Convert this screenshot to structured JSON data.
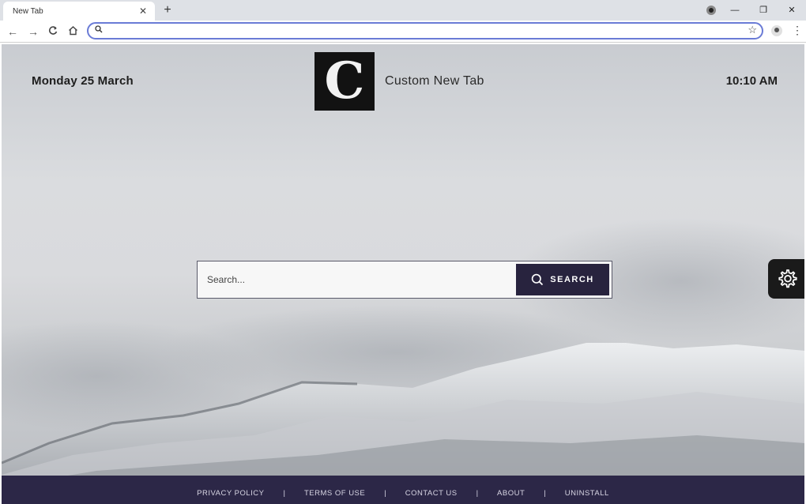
{
  "tab": {
    "title": "New Tab",
    "close": "✕",
    "new": "+"
  },
  "window_controls": {
    "minimize": "—",
    "maximize": "❐",
    "close": "✕"
  },
  "toolbar": {
    "back": "←",
    "forward": "→",
    "reload": "C",
    "home": "⌂",
    "address_value": "",
    "star": "☆",
    "menu": "⋮"
  },
  "page": {
    "date": "Monday 25 March",
    "time": "10:10 AM",
    "logo_letter": "C",
    "brand": "Custom New Tab",
    "search": {
      "placeholder": "Search...",
      "button_label": "SEARCH"
    },
    "footer_links": [
      "PRIVACY POLICY",
      "TERMS OF USE",
      "CONTACT US",
      "ABOUT",
      "UNINSTALL"
    ],
    "footer_separator": "|"
  },
  "colors": {
    "accent": "#28233e",
    "footer_bg": "#2c2747",
    "omnibox_focus": "#6a7bd6"
  },
  "icons": [
    "search-icon",
    "settings-gear-icon",
    "star-icon",
    "account-icon",
    "menu-icon",
    "home-icon",
    "reload-icon"
  ]
}
